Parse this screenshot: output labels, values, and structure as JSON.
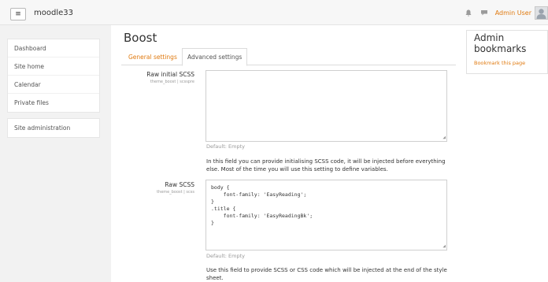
{
  "navbar": {
    "menu_icon": "≡",
    "site_name": "moodle33",
    "notification_icon": "bell-icon",
    "message_icon": "speech-bubble-icon",
    "user_name": "Admin User",
    "avatar_icon": "user-silhouette-icon"
  },
  "sidebar": {
    "items": [
      {
        "label": "Dashboard"
      },
      {
        "label": "Site home"
      },
      {
        "label": "Calendar"
      },
      {
        "label": "Private files"
      }
    ],
    "admin": {
      "label": "Site administration"
    }
  },
  "main": {
    "title": "Boost",
    "tabs": [
      {
        "label": "General settings"
      },
      {
        "label": "Advanced settings"
      }
    ],
    "settings": [
      {
        "name": "Raw initial SCSS",
        "key": "theme_boost | scsspre",
        "value": "",
        "default": "Default: Empty",
        "description": "In this field you can provide initialising SCSS code, it will be injected before everything else. Most of the time you will use this setting to define variables."
      },
      {
        "name": "Raw SCSS",
        "key": "theme_boost | scss",
        "lines": [
          "body {",
          "    font-family: 'EasyReading';",
          "}",
          ".title {",
          "    font-family: 'EasyReadingBk';",
          "}"
        ],
        "default": "Default: Empty",
        "description": "Use this field to provide SCSS or CSS code which will be injected at the end of the style sheet."
      }
    ]
  },
  "block": {
    "title": "Admin bookmarks",
    "link": "Bookmark this page"
  },
  "colors": {
    "accent": "#e07a10",
    "navbar_bg": "#f7f7f7",
    "drawer_bg": "#f2f2f2"
  }
}
